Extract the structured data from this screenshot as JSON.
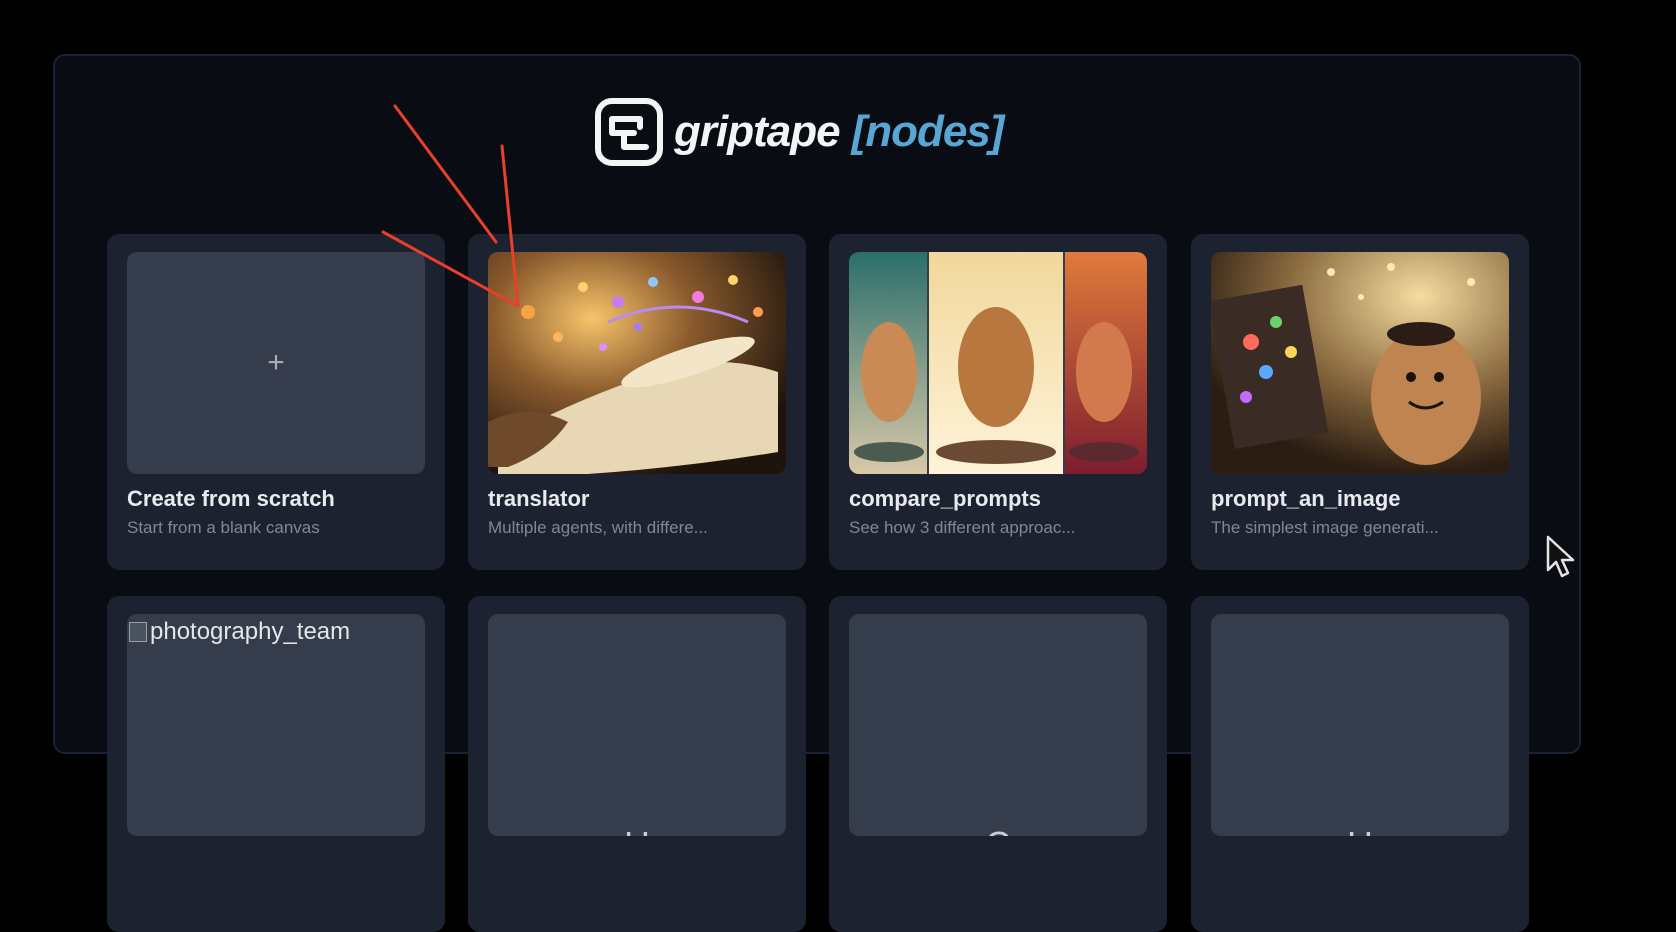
{
  "brand": {
    "name": "griptape",
    "accent": "[nodes]",
    "accent_color": "#58a6d4",
    "icon": "griptape-logo-icon"
  },
  "templates": [
    {
      "title": "Create from scratch",
      "description": "Start from a blank canvas",
      "thumb_icon": "plus-icon",
      "thumb_text": "+"
    },
    {
      "title": "translator",
      "description": "Multiple agents, with differe...",
      "thumb_icon": "scroll-magic-image"
    },
    {
      "title": "compare_prompts",
      "description": "See how 3 different approac...",
      "thumb_icon": "three-panel-robot-image"
    },
    {
      "title": "prompt_an_image",
      "description": "The simplest image generati...",
      "thumb_icon": "potato-painter-image"
    }
  ],
  "second_row": [
    {
      "alt_text": "photography_team",
      "thumb_icon": "broken-image-icon"
    },
    {
      "initial": "H"
    },
    {
      "initial": "C"
    },
    {
      "initial": "H"
    }
  ],
  "colors": {
    "background": "#000000",
    "panel": "#090c12",
    "card": "#1c2230",
    "annotation": "#e8402a"
  }
}
